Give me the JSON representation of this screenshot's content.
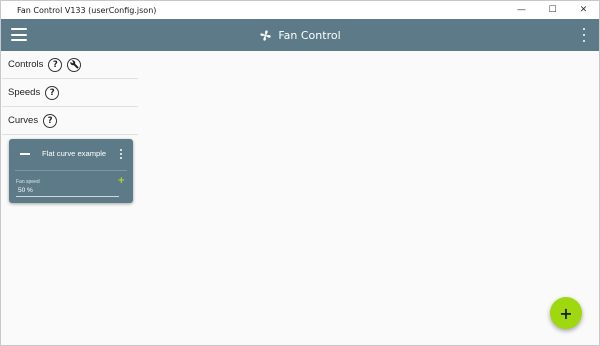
{
  "window": {
    "title": "Fan Control V133 (userConfig.json)",
    "controls": {
      "minimize": "—",
      "maximize": "☐",
      "close": "✕"
    }
  },
  "appbar": {
    "title": "Fan Control",
    "menu_icon": "hamburger-icon",
    "logo_icon": "fan-icon",
    "more_icon": "more-vert-icon"
  },
  "sidebar": {
    "sections": [
      {
        "label": "Controls",
        "help": "?",
        "has_tool": true
      },
      {
        "label": "Speeds",
        "help": "?"
      },
      {
        "label": "Curves",
        "help": "?"
      }
    ]
  },
  "curve_card": {
    "title": "Flat curve example",
    "field_label": "Fan speed",
    "field_value": "50 %",
    "add_glyph": "+"
  },
  "fab": {
    "glyph": "+"
  },
  "colors": {
    "appbar": "#5c7a87",
    "card": "#5c7a87",
    "fab": "#9fd80f",
    "accent_plus": "#b6e019",
    "background": "#fafafa"
  }
}
